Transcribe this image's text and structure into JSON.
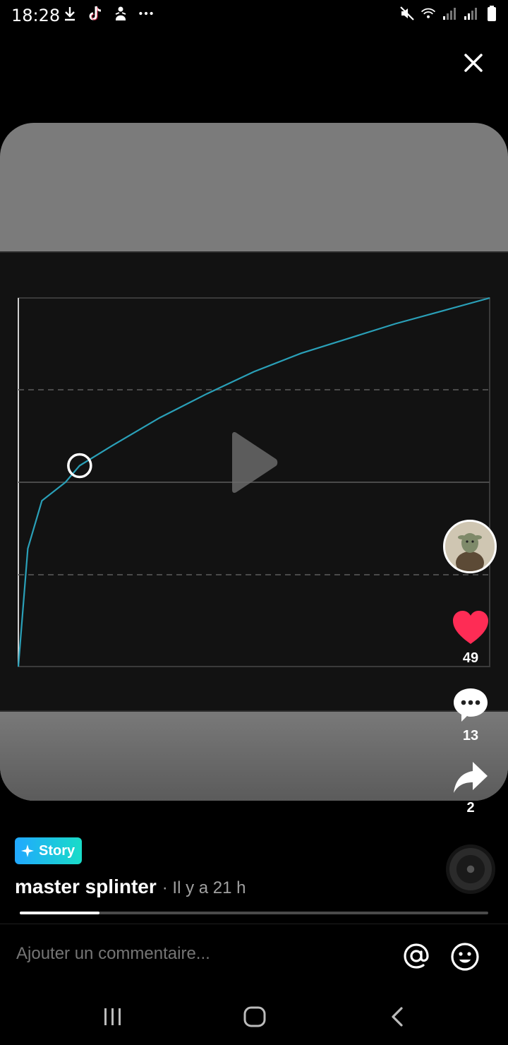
{
  "status_bar": {
    "time": "18:28",
    "left_icons": [
      "download-icon",
      "tiktok-icon",
      "person-icon",
      "more-dots-icon"
    ],
    "right_icons": [
      "mute-icon",
      "wifi-icon",
      "signal-icon",
      "signal-icon",
      "battery-icon"
    ]
  },
  "video": {
    "state": "paused",
    "colors": {
      "curve": "#2aa0b8",
      "frame_bg": "#121212",
      "card_bg": "#7b7b7b"
    }
  },
  "chart_data": {
    "type": "line",
    "series": [
      {
        "values_x": [
          0,
          0.02,
          0.05,
          0.1,
          0.13,
          0.2,
          0.3,
          0.4,
          0.5,
          0.6,
          0.7,
          0.8,
          0.9,
          1.0
        ],
        "values_y": [
          0,
          0.32,
          0.45,
          0.5,
          0.545,
          0.6,
          0.675,
          0.74,
          0.8,
          0.85,
          0.89,
          0.93,
          0.965,
          1.0
        ]
      }
    ],
    "highlight_point": {
      "x": 0.13,
      "y": 0.545
    },
    "xlim": [
      0,
      1
    ],
    "ylim": [
      0,
      1
    ],
    "grid": "horizontal dashed and solid lines"
  },
  "actions": {
    "likes": "49",
    "comments": "13",
    "shares": "2"
  },
  "caption": {
    "badge_label": "Story",
    "author": "master splinter",
    "time": "· Il y a 21 h"
  },
  "playback": {
    "progress_fraction": 0.17
  },
  "comment": {
    "placeholder": "Ajouter un commentaire..."
  },
  "nav_bar": {
    "buttons": [
      "recents-button",
      "home-button",
      "back-button"
    ]
  }
}
